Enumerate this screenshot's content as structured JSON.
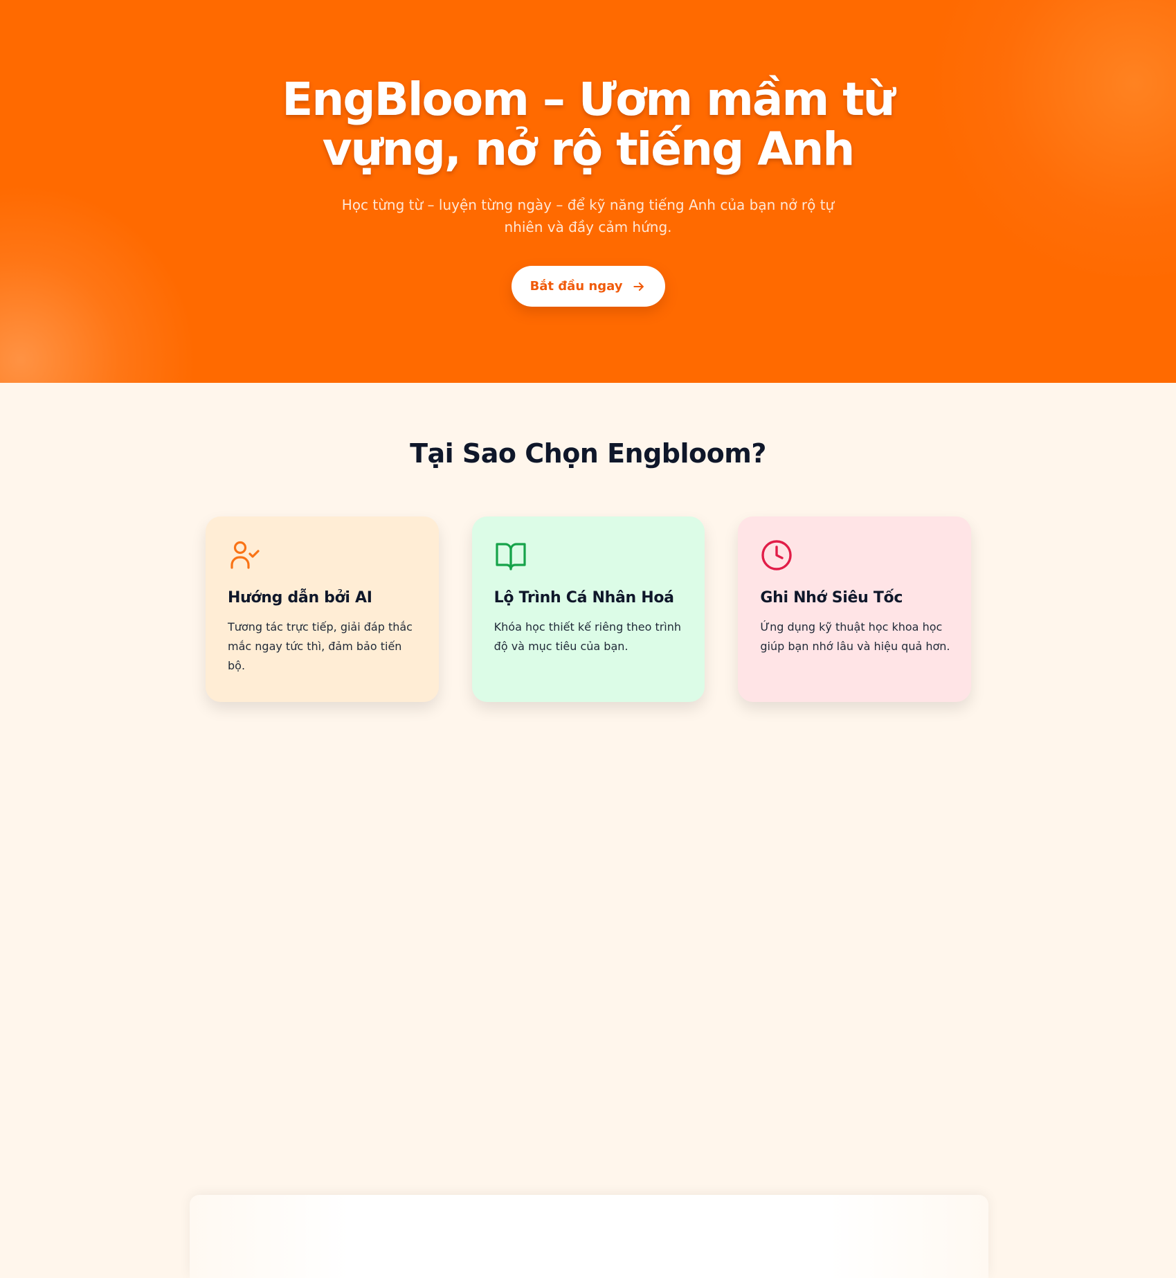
{
  "hero": {
    "title_line1": "EngBloom – Ươm mầm từ",
    "title_line2": "vựng, nở rộ tiếng Anh",
    "subtitle": "Học từng từ – luyện từng ngày – để kỹ năng tiếng Anh của bạn nở rộ tự nhiên và đầy cảm hứng.",
    "cta_label": "Bắt đầu ngay",
    "cta_icon": "arrow-right-icon"
  },
  "features": {
    "title": "Tại Sao Chọn Engbloom?",
    "cards": [
      {
        "icon": "user-check-icon",
        "color": "#f97316",
        "background": "#ffedd5",
        "title": "Hướng dẫn bởi AI",
        "description": "Tương tác trực tiếp, giải đáp thắc mắc ngay tức thì, đảm bảo tiến bộ."
      },
      {
        "icon": "book-open-icon",
        "color": "#16a34a",
        "background": "#dcfce7",
        "title": "Lộ Trình Cá Nhân Hoá",
        "description": "Khóa học thiết kế riêng theo trình độ và mục tiêu của bạn."
      },
      {
        "icon": "clock-icon",
        "color": "#e11d48",
        "background": "#ffe4e6",
        "title": "Ghi Nhớ Siêu Tốc",
        "description": "Ứng dụng kỹ thuật học khoa học giúp bạn nhớ lâu và hiệu quả hơn."
      }
    ]
  },
  "colors": {
    "hero_bg": "#ff6a00",
    "page_bg": "#fff6ec",
    "cta_text": "#f05a0a",
    "heading": "#0f172a"
  }
}
